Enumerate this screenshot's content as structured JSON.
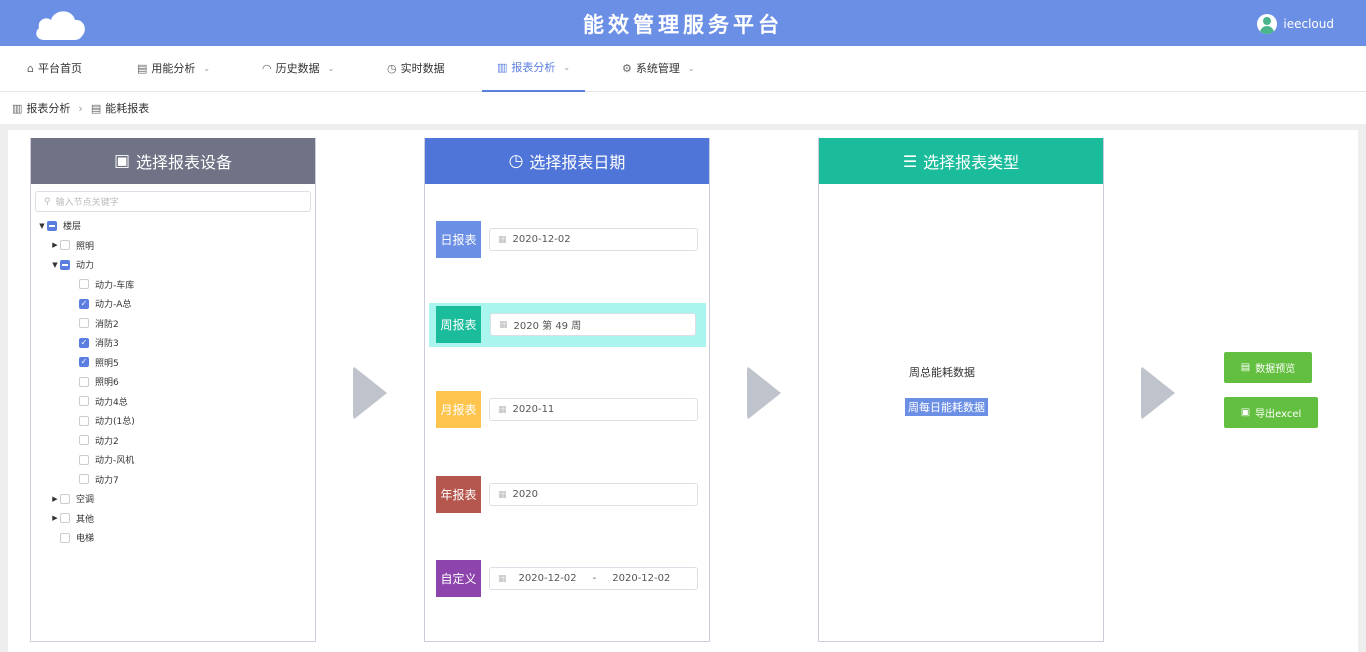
{
  "header": {
    "title": "能效管理服务平台",
    "username": "ieecloud"
  },
  "nav": [
    {
      "label": "平台首页",
      "icon": "home-icon"
    },
    {
      "label": "用能分析",
      "icon": "calendar-icon"
    },
    {
      "label": "历史数据",
      "icon": "gauge-icon"
    },
    {
      "label": "实时数据",
      "icon": "clock-icon"
    },
    {
      "label": "报表分析",
      "icon": "bar-chart-icon",
      "active": true
    },
    {
      "label": "系统管理",
      "icon": "gear-icon"
    }
  ],
  "breadcrumb": {
    "first": "报表分析",
    "second": "能耗报表"
  },
  "devicePanel": {
    "title": "选择报表设备",
    "color": "#6f7385",
    "searchPlaceholder": "输入节点关键字",
    "tree": [
      {
        "label": "楼层"
      },
      {
        "label": "照明"
      },
      {
        "label": "动力"
      },
      {
        "label": "动力-车库"
      },
      {
        "label": "动力-A总"
      },
      {
        "label": "消防2"
      },
      {
        "label": "消防3"
      },
      {
        "label": "照明5"
      },
      {
        "label": "照明6"
      },
      {
        "label": "动力4总"
      },
      {
        "label": "动力(1总)"
      },
      {
        "label": "动力2"
      },
      {
        "label": "动力-风机"
      },
      {
        "label": "动力7"
      },
      {
        "label": "空调"
      },
      {
        "label": "其他"
      },
      {
        "label": "电梯"
      }
    ]
  },
  "datePanel": {
    "title": "选择报表日期",
    "color": "#4f75d8",
    "rows": [
      {
        "tag": "日报表",
        "value": "2020-12-02",
        "color": "#6c8fe6"
      },
      {
        "tag": "周报表",
        "value": "2020 第 49 周",
        "color": "#1bbc9b"
      },
      {
        "tag": "月报表",
        "value": "2020-11",
        "color": "#ffc44d"
      },
      {
        "tag": "年报表",
        "value": "2020",
        "color": "#b5574e"
      },
      {
        "tag": "自定义",
        "start": "2020-12-02",
        "dash": "-",
        "end": "2020-12-02",
        "color": "#8e44ad"
      }
    ]
  },
  "typePanel": {
    "title": "选择报表类型",
    "color": "#1bbc9b",
    "options": [
      "周总能耗数据",
      "周每日能耗数据"
    ]
  },
  "actions": {
    "preview": "数据预览",
    "export": "导出excel",
    "color": "#63bf3f"
  }
}
